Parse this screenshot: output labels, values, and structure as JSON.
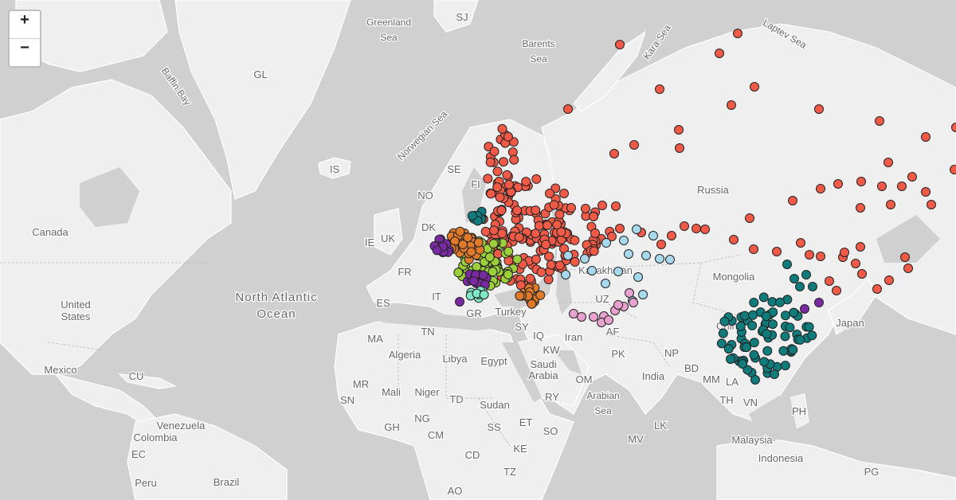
{
  "zoom": {
    "in_label": "+",
    "out_label": "−"
  },
  "colors": {
    "water": "#d0d0d0",
    "land": "#efefef",
    "border": "#ffffff",
    "label": "#666666",
    "red_series": "#f05a46",
    "teal_series": "#0f7b7b",
    "green_series": "#9ccf3a",
    "orange_series": "#e07a2a",
    "purple_series": "#7a2aa0",
    "light_blue_series": "#a8d8ec",
    "pink_series": "#e8a2cf"
  },
  "labels": {
    "greenland_sea": [
      "Greenland",
      "Sea"
    ],
    "barents_sea": [
      "Barents",
      "Sea"
    ],
    "kara_sea": "Kara Sea",
    "laptev_sea": "Laptev Sea",
    "norwegian_sea": "Norwegian Sea",
    "baffin_bay": "Baffin Bay",
    "north_atlantic": [
      "North Atlantic",
      "Ocean"
    ],
    "arabian_sea": [
      "Arabian",
      "Sea"
    ],
    "countries": [
      "SJ",
      "GL",
      "IS",
      "SE",
      "FI",
      "NO",
      "DK",
      "IE",
      "UK",
      "FR",
      "ES",
      "Canada",
      "United",
      "States",
      "Mexico",
      "CU",
      "Russia",
      "Mongolia",
      "Kazakhstan",
      "UZ",
      "Turkey",
      "GR",
      "IT",
      "SY",
      "IQ",
      "TN",
      "MA",
      "Algeria",
      "Libya",
      "Egypt",
      "KW",
      "Iran",
      "AF",
      "PK",
      "Saudi",
      "Arabia",
      "OM",
      "India",
      "NP",
      "BD",
      "MM",
      "LA",
      "TH",
      "VN",
      "PH",
      "China",
      "Japan",
      "Malaysia",
      "Indonesia",
      "PG",
      "Mali",
      "Niger",
      "MR",
      "SN",
      "TD",
      "Sudan",
      "ET",
      "RY",
      "NG",
      "GH",
      "CM",
      "SS",
      "SO",
      "KE",
      "CD",
      "TZ",
      "AO",
      "Venezuela",
      "Colombia",
      "EC",
      "Peru",
      "Brazil",
      "MV",
      "LK"
    ]
  }
}
